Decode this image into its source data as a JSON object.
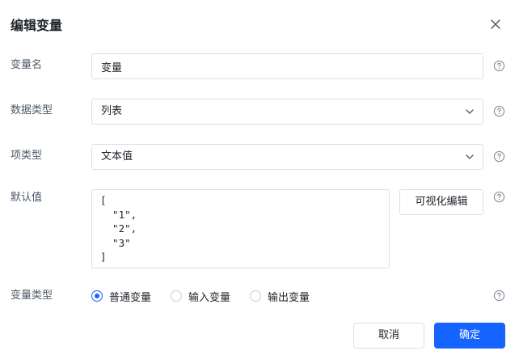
{
  "dialog": {
    "title": "编辑变量"
  },
  "form": {
    "var_name": {
      "label": "变量名",
      "value": "变量"
    },
    "data_type": {
      "label": "数据类型",
      "selected": "列表"
    },
    "item_type": {
      "label": "项类型",
      "selected": "文本值"
    },
    "default_value": {
      "label": "默认值",
      "value": "[\n  \"1\",\n  \"2\",\n  \"3\"\n]",
      "visual_edit_label": "可视化编辑"
    },
    "var_type": {
      "label": "变量类型",
      "options": [
        {
          "label": "普通变量",
          "checked": true
        },
        {
          "label": "输入变量",
          "checked": false
        },
        {
          "label": "输出变量",
          "checked": false
        }
      ]
    }
  },
  "footer": {
    "cancel_label": "取消",
    "ok_label": "确定"
  },
  "colors": {
    "primary": "#1664ff",
    "border": "#dcdfe6",
    "label_text": "#4e5969"
  },
  "icons": {
    "close": "close-icon",
    "help": "question-circle-icon",
    "dropdown": "chevron-down-icon"
  }
}
